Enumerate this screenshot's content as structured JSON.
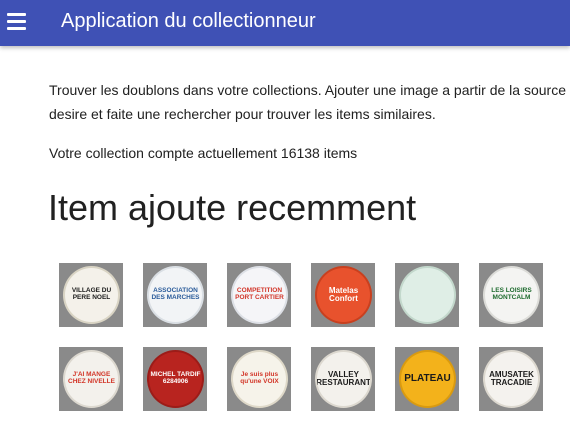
{
  "appbar": {
    "title": "Application du collectionneur",
    "menu_icon": "hamburger-menu-icon"
  },
  "main": {
    "intro_line1": "Trouver les doublons dans votre collections. Ajouter une image a partir de la source",
    "intro_line2": "desire et faite une rechercher pour trouver les items similaires.",
    "collection_count": "Votre collection compte actuellement 16138 items",
    "section_title": "Item ajoute recemment"
  },
  "items": [
    {
      "label": "VILLAGE DU PERE NOEL",
      "bg": "#f4f1ea",
      "fg": "#1a1a1a",
      "border": "#d9d4c4"
    },
    {
      "label": "ASSOCIATION DES MARCHES",
      "bg": "#f2f4f6",
      "fg": "#2a5b9a",
      "border": "#dadfe4"
    },
    {
      "label": "COMPETITION PORT CARTIER",
      "bg": "#f5f5f8",
      "fg": "#d2362a",
      "border": "#dde0e6"
    },
    {
      "label": "Matelas Confort",
      "bg": "#e8522d",
      "fg": "#ffffff",
      "border": "#c8401f"
    },
    {
      "label": "",
      "bg": "#dfeee6",
      "fg": "#2d6e4e",
      "border": "#c3d8cc"
    },
    {
      "label": "LES LOISIRS MONTCALM",
      "bg": "#f4f4f2",
      "fg": "#1e6b2e",
      "border": "#dcdcd8"
    },
    {
      "label": "J'AI MANGE CHEZ NIVELLE",
      "bg": "#f3f1ec",
      "fg": "#d23426",
      "border": "#dcd8cf"
    },
    {
      "label": "MICHEL TARDIF 6284906",
      "bg": "#b8241f",
      "fg": "#ffffff",
      "border": "#9c1c18"
    },
    {
      "label": "Je suis plus qu'une VOIX",
      "bg": "#f6f3ea",
      "fg": "#d23426",
      "border": "#ded8c8"
    },
    {
      "label": "VALLEY RESTAURANT",
      "bg": "#f3f1ec",
      "fg": "#1a1a1a",
      "border": "#dcd8cf"
    },
    {
      "label": "PLATEAU",
      "bg": "#f3b21b",
      "fg": "#1a1a1a",
      "border": "#d99a10"
    },
    {
      "label": "AMUSATEK TRACADIE",
      "bg": "#f4f2ee",
      "fg": "#1a1a1a",
      "border": "#dcd8cf"
    }
  ]
}
